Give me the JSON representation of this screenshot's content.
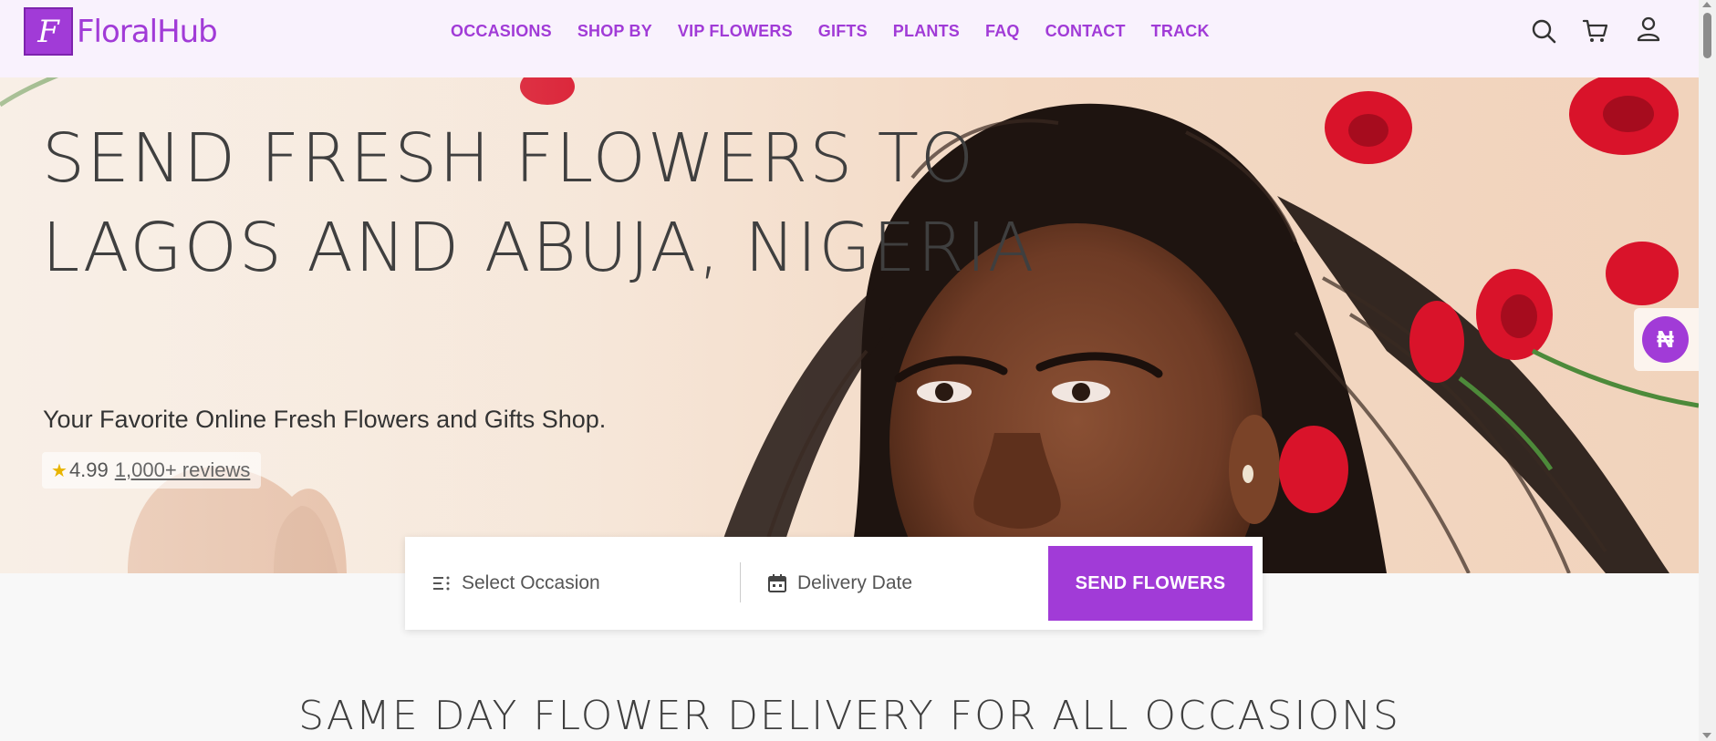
{
  "brand": {
    "logo_letter": "F",
    "name": "FloralHub",
    "accent_color": "#a13bd7"
  },
  "nav": {
    "items": [
      {
        "label": "OCCASIONS"
      },
      {
        "label": "SHOP BY"
      },
      {
        "label": "VIP FLOWERS"
      },
      {
        "label": "GIFTS"
      },
      {
        "label": "PLANTS"
      },
      {
        "label": "FAQ"
      },
      {
        "label": "CONTACT"
      },
      {
        "label": "TRACK"
      }
    ]
  },
  "header_icons": [
    "search-icon",
    "cart-icon",
    "user-icon"
  ],
  "hero": {
    "title": "SEND FRESH FLOWERS TO LAGOS AND ABUJA, NIGERIA",
    "subtitle": "Your Favorite Online Fresh Flowers and Gifts Shop.",
    "rating_value": "4.99",
    "rating_reviews": "1,000+ reviews",
    "currency_symbol": "₦"
  },
  "search": {
    "occasion_placeholder": "Select Occasion",
    "date_placeholder": "Delivery Date",
    "submit_label": "SEND FLOWERS"
  },
  "section": {
    "title": "SAME DAY FLOWER DELIVERY FOR ALL OCCASIONS"
  }
}
